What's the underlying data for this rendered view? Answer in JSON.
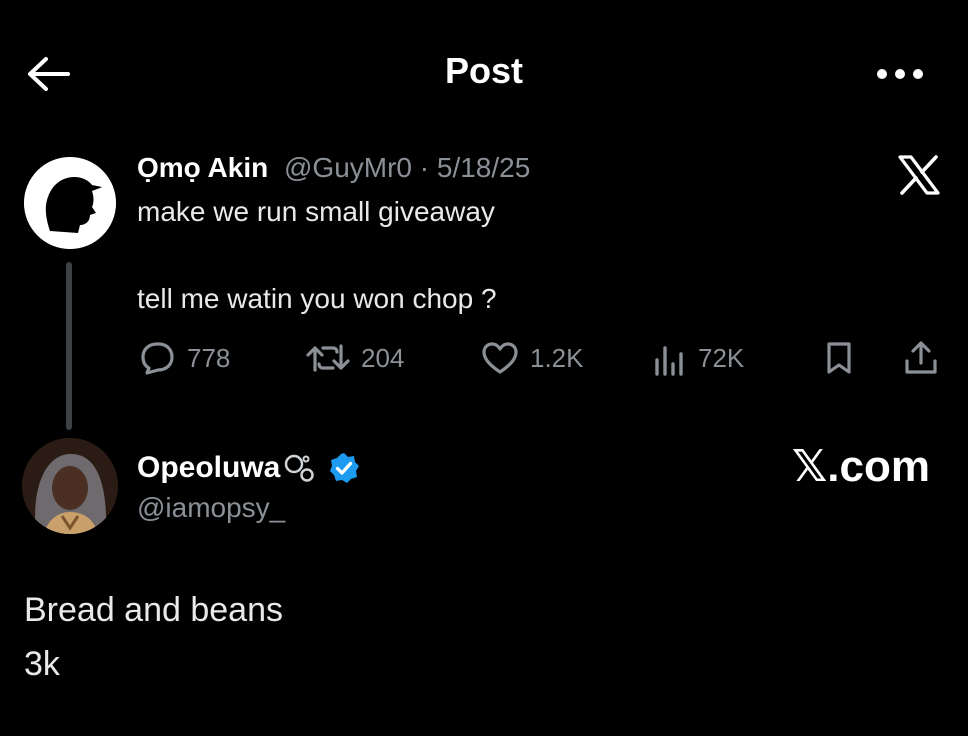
{
  "header": {
    "title": "Post",
    "back_icon": "arrow-left-icon",
    "more_icon": "more-horizontal-icon"
  },
  "original_post": {
    "display_name": "Ọmọ Akin",
    "handle": "@GuyMr0",
    "separator": " · ",
    "date": "5/18/25",
    "line1": "make we run small giveaway",
    "line2": "tell me watin you won chop ?",
    "brand_icon": "x-logo-icon",
    "actions": {
      "replies": "778",
      "reposts": "204",
      "likes": "1.2K",
      "views": "72K"
    }
  },
  "reply": {
    "display_name": "Opeoluwa",
    "handle": "@iamopsy_",
    "body_line1": "Bread and beans",
    "body_line2": "3k",
    "verified_icon": "verified-badge-icon"
  },
  "watermark": {
    "text": "𝕏.com"
  },
  "colors": {
    "background": "#000000",
    "text": "#e7e9ea",
    "muted": "#8b9096",
    "verified": "#1d9bf0",
    "thread_line": "#3e4144"
  }
}
